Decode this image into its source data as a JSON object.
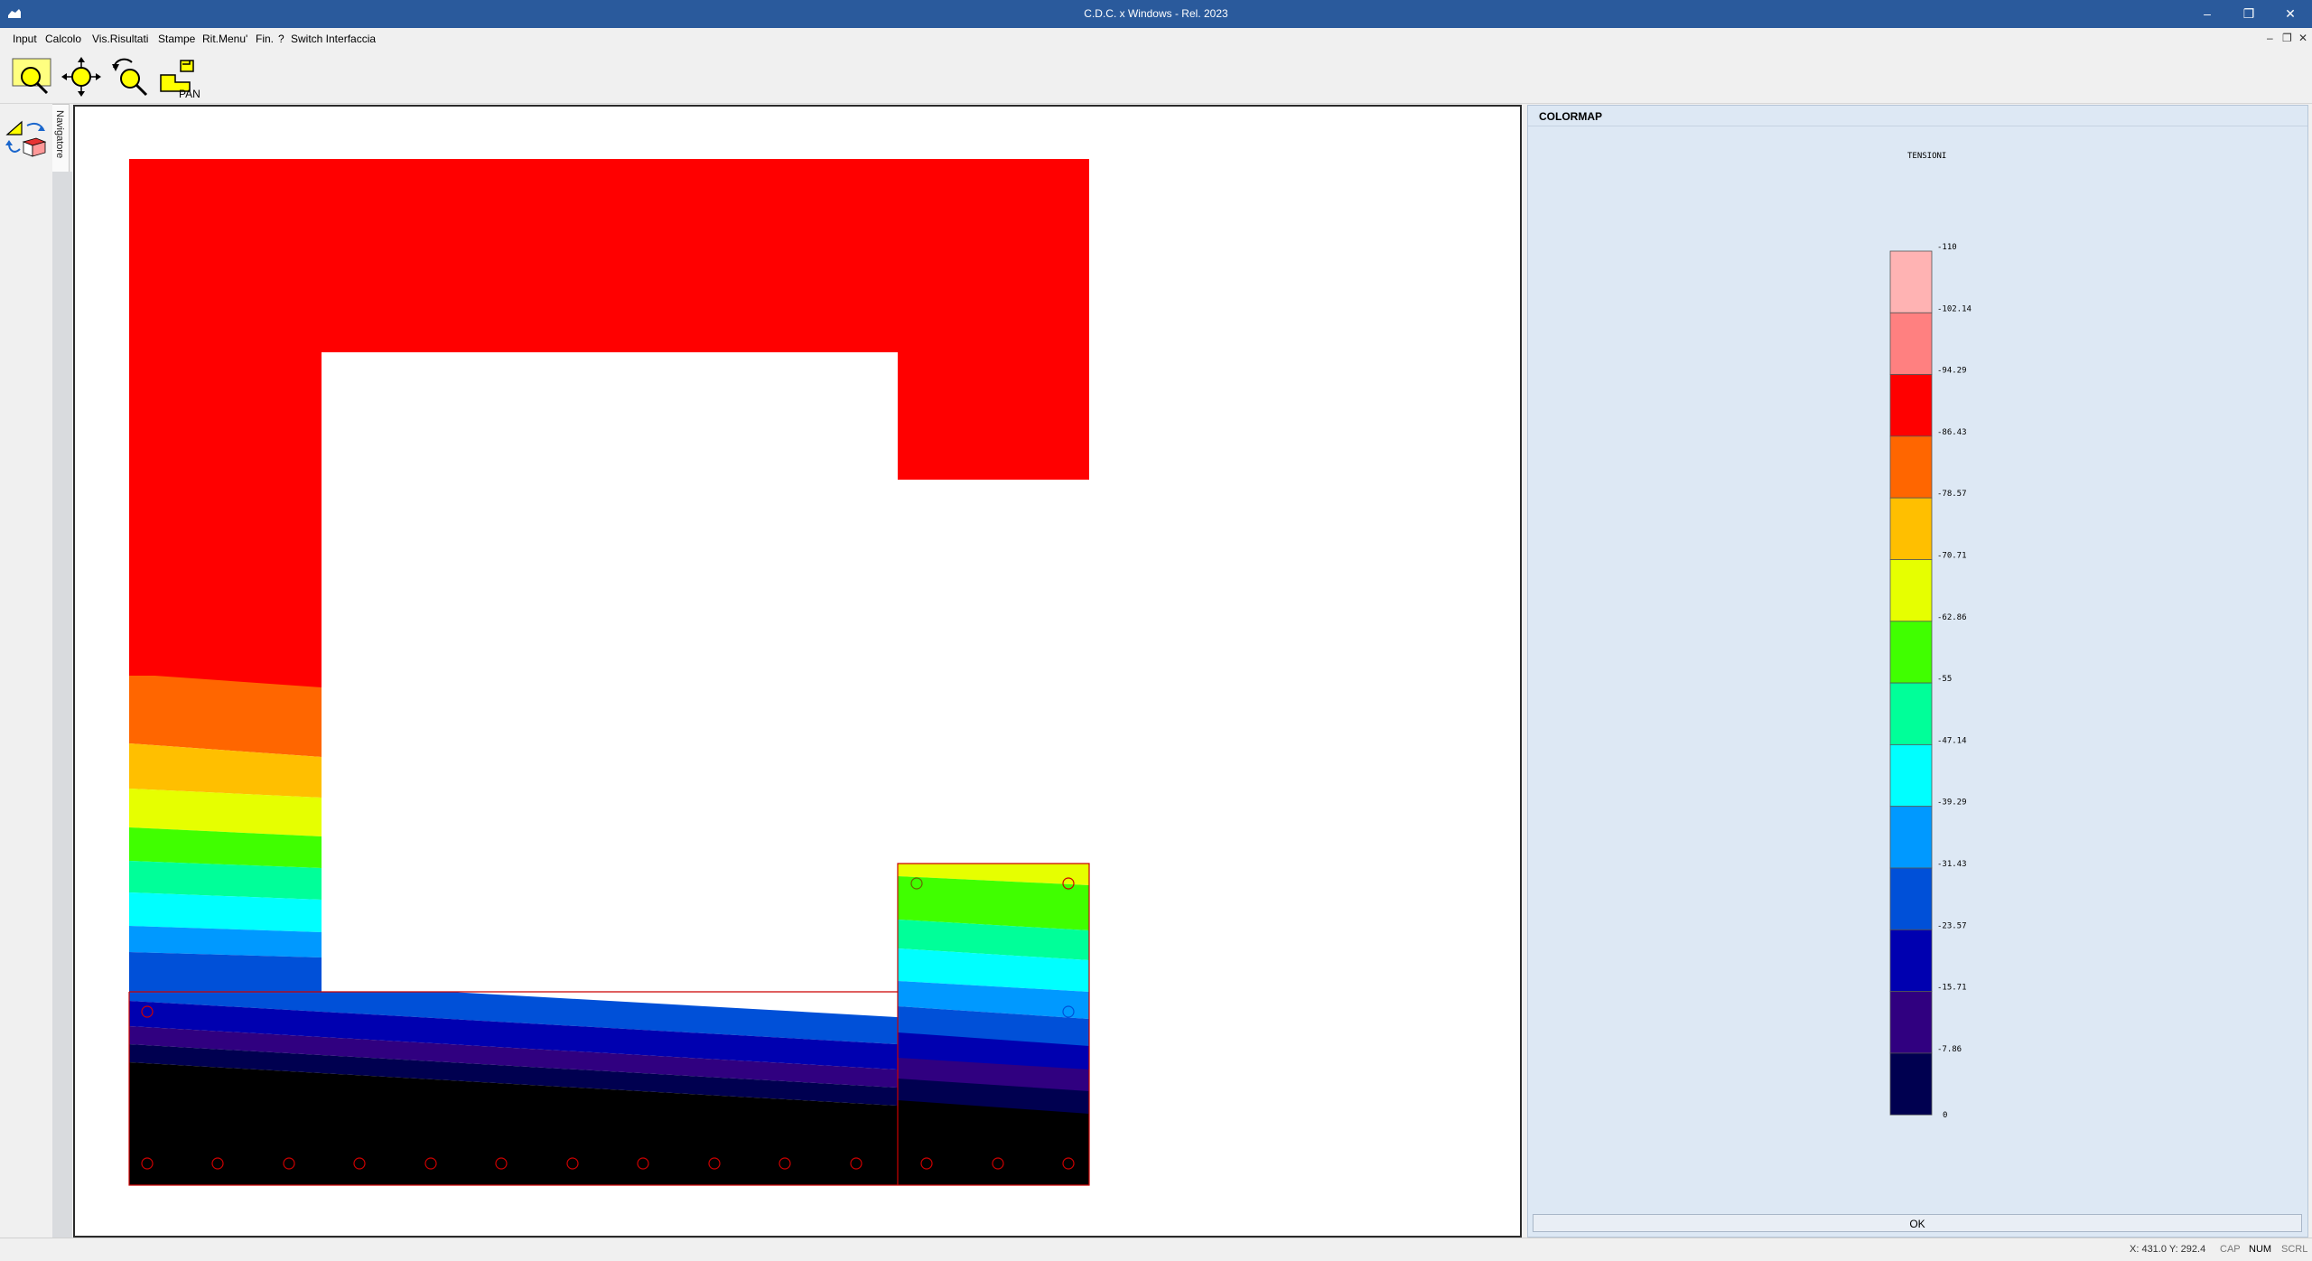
{
  "window": {
    "title": "C.D.C. x Windows - Rel. 2023",
    "minimize": "–",
    "restore": "❐",
    "close": "✕"
  },
  "menu": [
    {
      "label": "Input"
    },
    {
      "label": "Calcolo"
    },
    {
      "label": "Vis.Risultati"
    },
    {
      "label": "Stampe"
    },
    {
      "label": "Rit.Menu'"
    },
    {
      "label": "Fin."
    },
    {
      "label": "?"
    },
    {
      "label": "Switch Interfaccia"
    }
  ],
  "mdi_controls": {
    "minimize": "–",
    "restore": "❐",
    "close": "✕"
  },
  "toolbar": [
    {
      "name": "zoom-window-icon"
    },
    {
      "name": "zoom-extents-icon"
    },
    {
      "name": "zoom-previous-icon"
    },
    {
      "name": "pan-icon",
      "text": "PAN"
    }
  ],
  "navigator": {
    "label": "Navigatore"
  },
  "colormap": {
    "title": "COLORMAP",
    "subtitle": "TENSIONI",
    "bands": [
      {
        "label": "-110",
        "color": "#ffb3b3"
      },
      {
        "label": "-102.14",
        "color": "#ff8080"
      },
      {
        "label": "-94.29",
        "color": "#ff0000"
      },
      {
        "label": "-86.43",
        "color": "#ff6600"
      },
      {
        "label": "-78.57",
        "color": "#ffbf00"
      },
      {
        "label": "-70.71",
        "color": "#e6ff00"
      },
      {
        "label": "-62.86",
        "color": "#40ff00"
      },
      {
        "label": "-55",
        "color": "#00ff99"
      },
      {
        "label": "-47.14",
        "color": "#00ffff"
      },
      {
        "label": "-39.29",
        "color": "#0099ff"
      },
      {
        "label": "-31.43",
        "color": "#0050d8"
      },
      {
        "label": "-23.57",
        "color": "#0000b0"
      },
      {
        "label": "-15.71",
        "color": "#300080"
      },
      {
        "label": "-7.86",
        "color": "#000050"
      }
    ],
    "last_label": "0",
    "ok": "OK"
  },
  "section_colors": {
    "red": "#ff0000",
    "orange": "#ff6600",
    "amber": "#ffbf00",
    "yellow": "#e6ff00",
    "green": "#40ff00",
    "seagreen": "#00ff99",
    "cyan": "#00ffff",
    "sky": "#0099ff",
    "blue": "#0050d8",
    "navy": "#0000b0",
    "purple": "#300080",
    "darknavy": "#000050",
    "black": "#000000",
    "outline": "#cc0000"
  },
  "status": {
    "coords": "X: 431.0  Y: 292.4",
    "cap": "CAP",
    "num": "NUM",
    "scrl": "SCRL"
  }
}
